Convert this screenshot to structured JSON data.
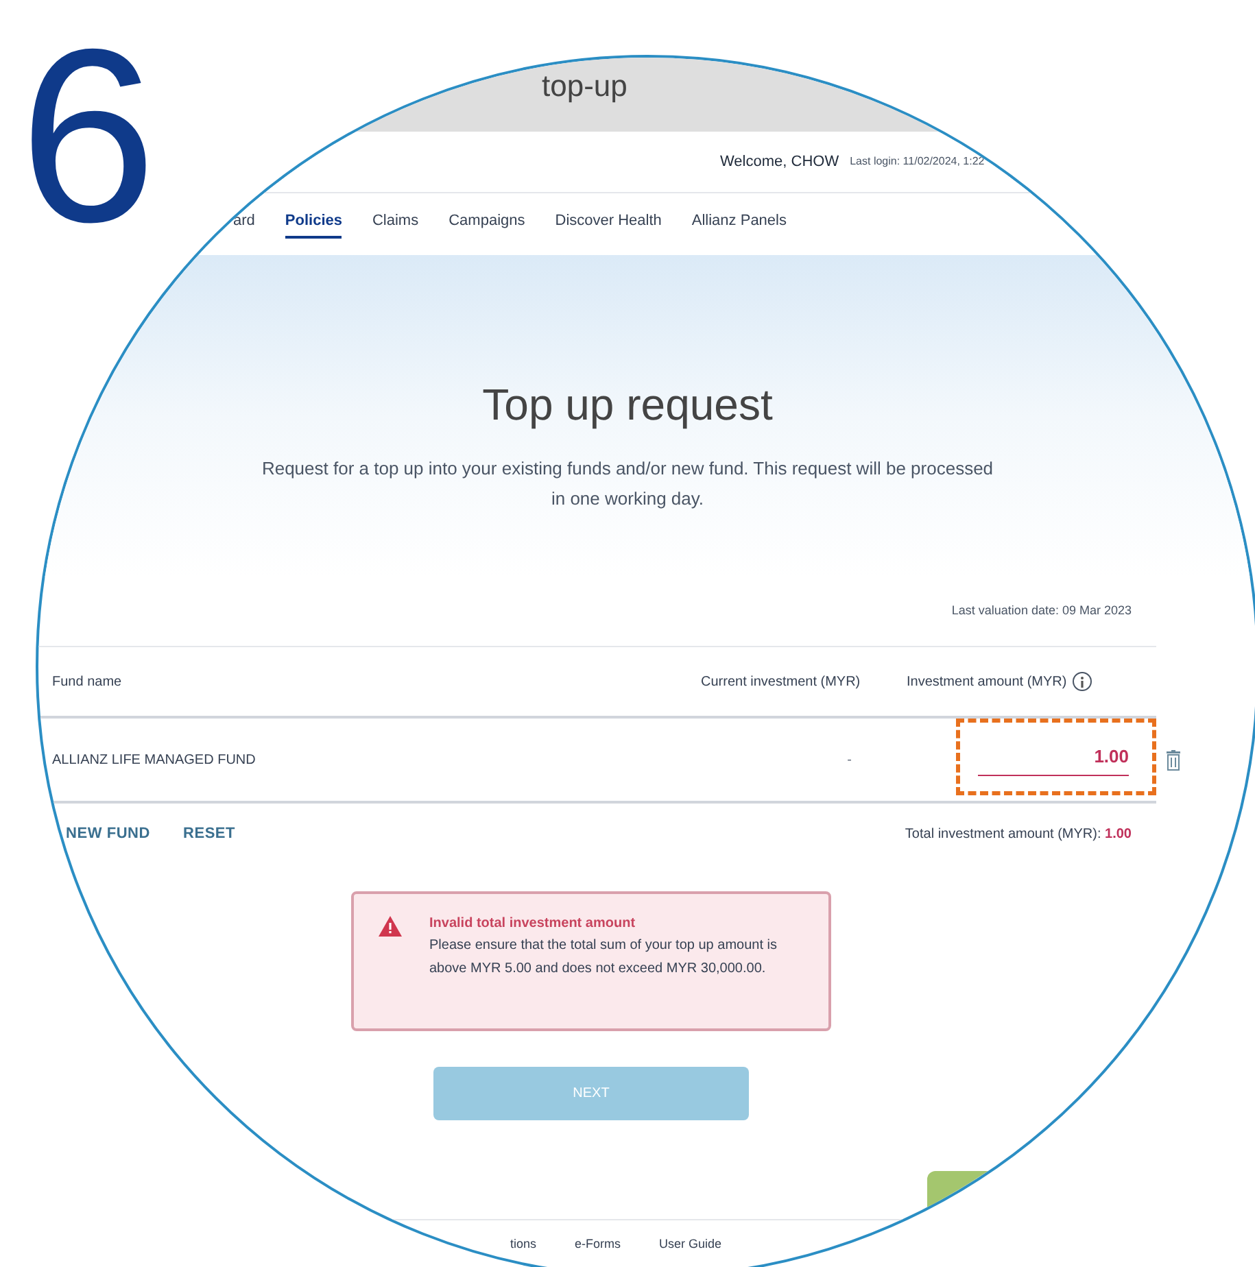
{
  "step_number": "6",
  "page_title": "top-up",
  "header": {
    "welcome": "Welcome, CHOW",
    "last_login": "Last login: 11/02/2024, 1:22"
  },
  "nav": [
    {
      "label": "ard",
      "selected": false
    },
    {
      "label": "Policies",
      "selected": true
    },
    {
      "label": "Claims",
      "selected": false
    },
    {
      "label": "Campaigns",
      "selected": false
    },
    {
      "label": "Discover Health",
      "selected": false
    },
    {
      "label": "Allianz Panels",
      "selected": false
    }
  ],
  "hero": {
    "title": "Top up request",
    "description": "Request for a top up into your existing funds and/or new fund. This request will be processed in one working day."
  },
  "valuation_date": "Last valuation date: 09 Mar 2023",
  "table": {
    "columns": [
      "Fund name",
      "Current investment (MYR)",
      "Investment amount (MYR)"
    ],
    "rows": [
      {
        "fund": "ALLIANZ LIFE MANAGED FUND",
        "current": "-",
        "amount": "1.00",
        "invalid": true,
        "highlighted": true
      }
    ]
  },
  "actions": [
    "NEW FUND",
    "RESET"
  ],
  "total": {
    "label": "Total investment amount (MYR):",
    "value": "1.00",
    "invalid": true
  },
  "alert": {
    "title": "Invalid total investment amount",
    "message": "Please ensure that the total sum of your top up amount is above MYR 5.00 and does not exceed MYR 30,000.00."
  },
  "next_button": {
    "label": "NEXT",
    "disabled": true
  },
  "footer": [
    "tions",
    "e-Forms",
    "User Guide"
  ]
}
